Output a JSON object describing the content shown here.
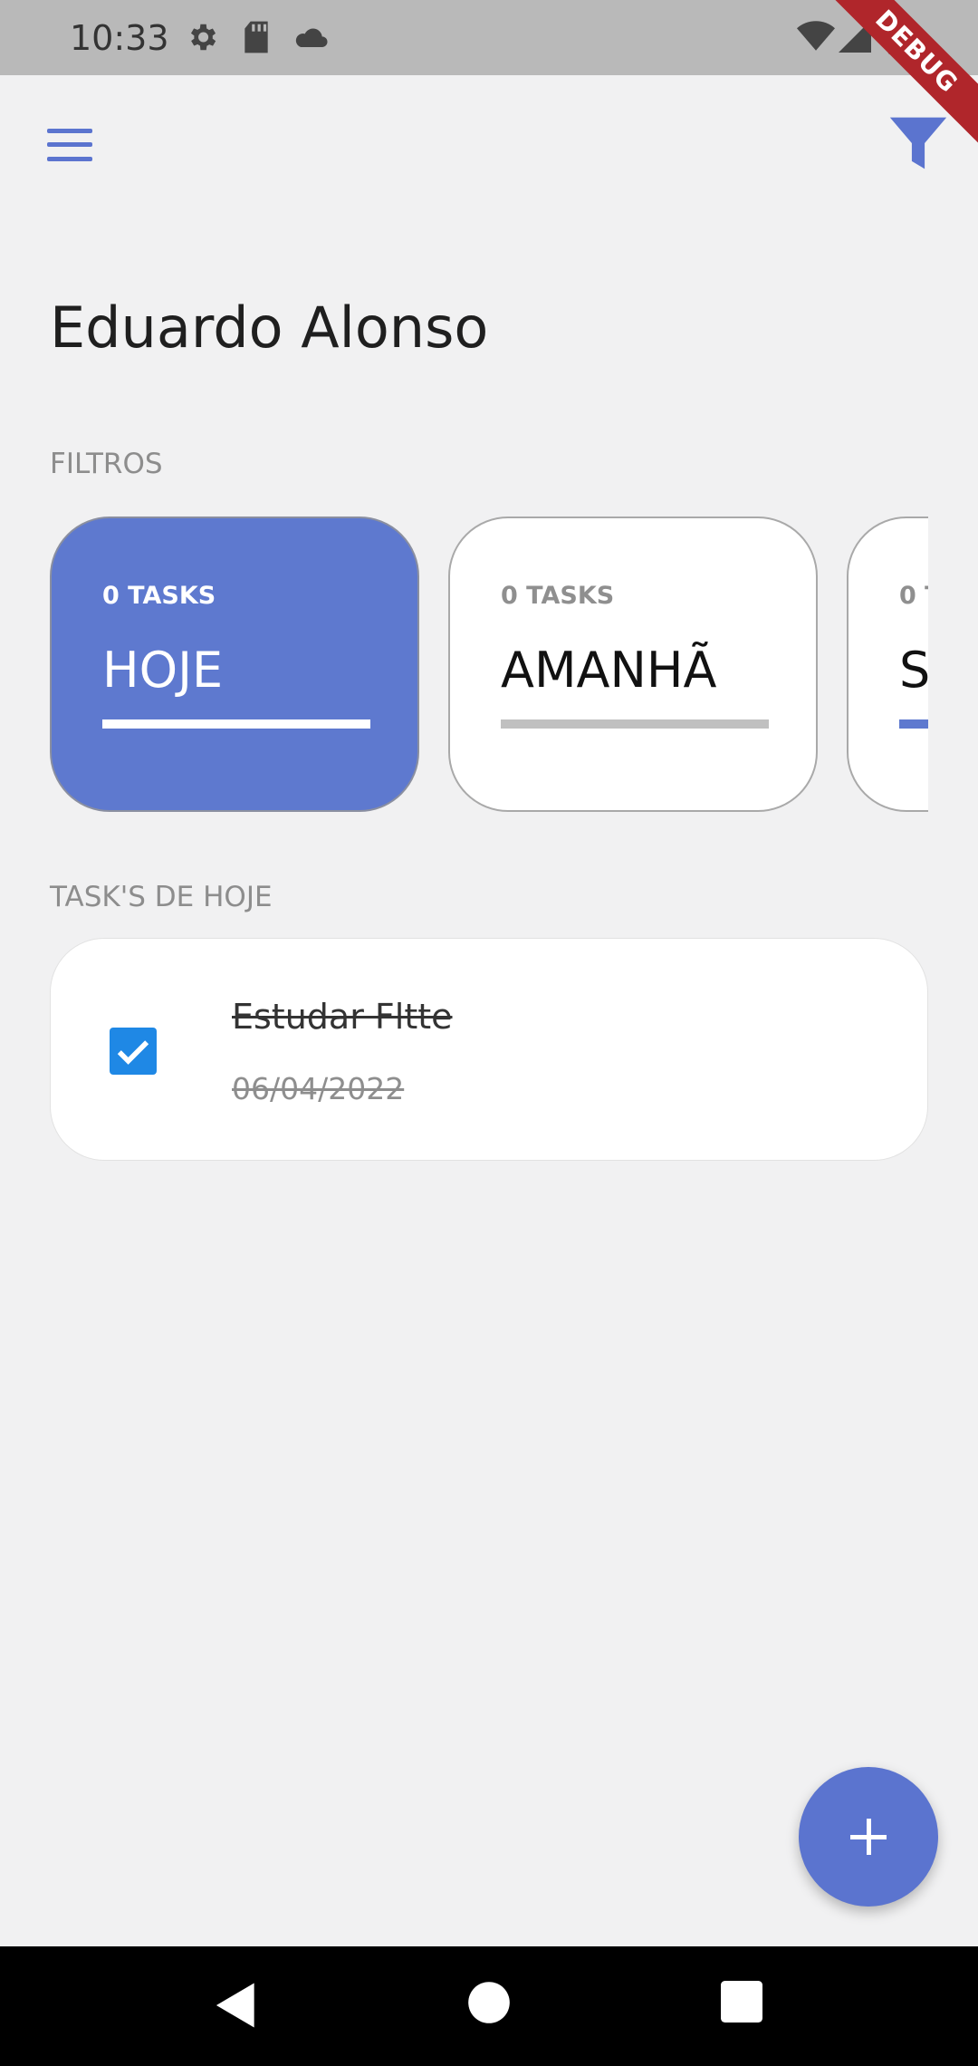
{
  "status_bar": {
    "time": "10:33"
  },
  "debug_banner": "DEBUG",
  "user": {
    "name": "Eduardo Alonso"
  },
  "sections": {
    "filters": "FILTROS",
    "tasks": "TASK'S DE HOJE"
  },
  "filters": [
    {
      "count": "0 TASKS",
      "title": "HOJE"
    },
    {
      "count": "0 TASKS",
      "title": "AMANHÃ"
    },
    {
      "count": "0 T",
      "title": "S"
    }
  ],
  "task": {
    "title": "Estudar Fltte",
    "date": "06/04/2022",
    "checked": true
  },
  "colors": {
    "accent": "#5e79cf",
    "checkbox": "#1f88e5",
    "background": "#f1f1f2"
  }
}
